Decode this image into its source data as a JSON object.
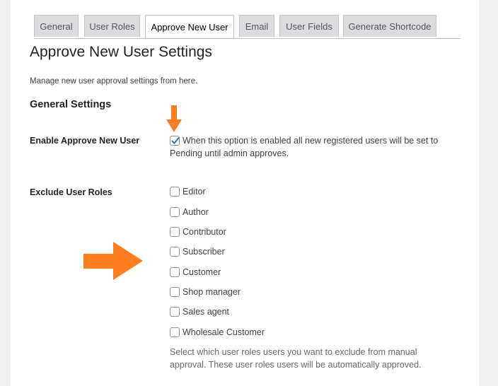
{
  "tabs": [
    {
      "label": "General",
      "active": false
    },
    {
      "label": "User Roles",
      "active": false
    },
    {
      "label": "Approve New User",
      "active": true
    },
    {
      "label": "Email",
      "active": false
    },
    {
      "label": "User Fields",
      "active": false
    },
    {
      "label": "Generate Shortcode",
      "active": false
    }
  ],
  "page": {
    "title": "Approve New User Settings",
    "description": "Manage new user approval settings from here."
  },
  "general_settings": {
    "heading": "General Settings",
    "enable": {
      "label": "Enable Approve New User",
      "checked": true,
      "text": "When this option is enabled all new registered users will be set to Pending until admin approves."
    },
    "exclude": {
      "label": "Exclude User Roles",
      "roles": [
        {
          "label": "Editor",
          "checked": false
        },
        {
          "label": "Author",
          "checked": false
        },
        {
          "label": "Contributor",
          "checked": false
        },
        {
          "label": "Subscriber",
          "checked": false
        },
        {
          "label": "Customer",
          "checked": false
        },
        {
          "label": "Shop manager",
          "checked": false
        },
        {
          "label": "Sales agent",
          "checked": false
        },
        {
          "label": "Wholesale Customer",
          "checked": false
        }
      ],
      "help": "Select which user roles users you want to exclude from manual approval. These user roles users will be automatically approved."
    }
  },
  "colors": {
    "annotation_arrow": "#fd7d22",
    "checkmark": "#2271b1",
    "active_tab_bg": "#ffffff",
    "inactive_tab_bg": "#dcdcde"
  },
  "icons": {
    "annotation_down": "arrow-down-icon",
    "annotation_right": "arrow-right-icon",
    "checkmark": "checkmark-icon"
  }
}
